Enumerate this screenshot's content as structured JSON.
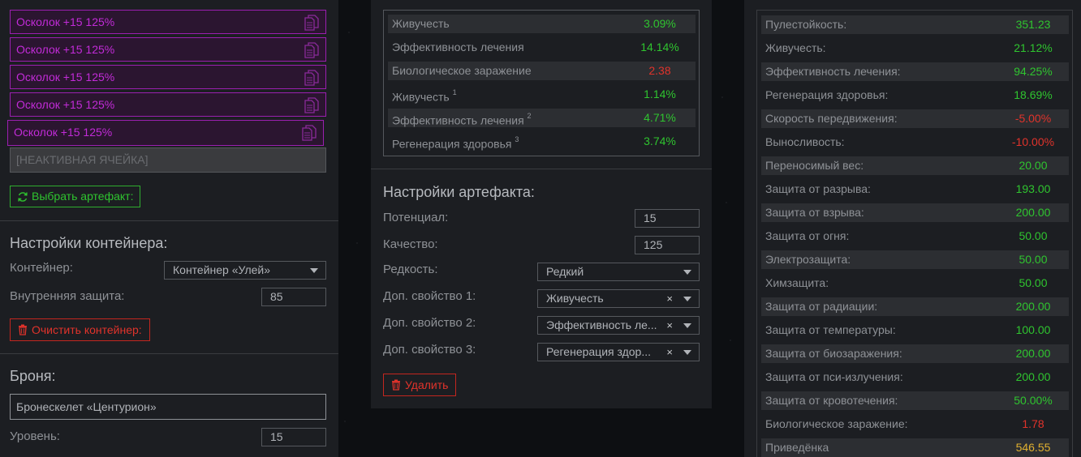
{
  "left": {
    "shards": [
      {
        "label": "Осколок +15 125%"
      },
      {
        "label": "Осколок +15 125%"
      },
      {
        "label": "Осколок +15 125%"
      },
      {
        "label": "Осколок +15 125%"
      },
      {
        "label": "Осколок +15 125%"
      }
    ],
    "inactive_cell": "[НЕАКТИВНАЯ ЯЧЕЙКА]",
    "choose_artifact": "Выбрать артефакт:",
    "container_settings_title": "Настройки контейнера:",
    "container_label": "Контейнер:",
    "container_value": "Контейнер «Улей»",
    "inner_protection_label": "Внутренняя защита:",
    "inner_protection_value": "85",
    "clear_container": "Очистить контейнер:",
    "armor_title": "Броня:",
    "armor_value": "Бронескелет «Центурион»",
    "level_label": "Уровень:",
    "level_value": "15"
  },
  "mid": {
    "stats": [
      {
        "name": "Живучесть",
        "sup": "",
        "value": "3.09%",
        "color": "green"
      },
      {
        "name": "Эффективность лечения",
        "sup": "",
        "value": "14.14%",
        "color": "green"
      },
      {
        "name": "Биологическое заражение",
        "sup": "",
        "value": "2.38",
        "color": "red"
      },
      {
        "name": "Живучесть",
        "sup": "1",
        "value": "1.14%",
        "color": "green"
      },
      {
        "name": "Эффективность лечения",
        "sup": "2",
        "value": "4.71%",
        "color": "green"
      },
      {
        "name": "Регенерация здоровья",
        "sup": "3",
        "value": "3.74%",
        "color": "green"
      }
    ],
    "artifact_settings_title": "Настройки артефакта:",
    "potential_label": "Потенциал:",
    "potential_value": "15",
    "quality_label": "Качество:",
    "quality_value": "125",
    "rarity_label": "Редкость:",
    "rarity_value": "Редкий",
    "extra1_label": "Доп. свойство 1:",
    "extra1_value": "Живучесть",
    "extra2_label": "Доп. свойство 2:",
    "extra2_value": "Эффективность ле...",
    "extra3_label": "Доп. свойство 3:",
    "extra3_value": "Регенерация здор...",
    "clear_symbol": "×",
    "delete_button": "Удалить"
  },
  "right": {
    "stats": [
      {
        "name": "Пулестойкость:",
        "value": "351.23",
        "color": "green"
      },
      {
        "name": "Живучесть:",
        "value": "21.12%",
        "color": "green"
      },
      {
        "name": "Эффективность лечения:",
        "value": "94.25%",
        "color": "green"
      },
      {
        "name": "Регенерация здоровья:",
        "value": "18.69%",
        "color": "green"
      },
      {
        "name": "Скорость передвижения:",
        "value": "-5.00%",
        "color": "red"
      },
      {
        "name": "Выносливость:",
        "value": "-10.00%",
        "color": "red"
      },
      {
        "name": "Переносимый вес:",
        "value": "20.00",
        "color": "green"
      },
      {
        "name": "Защита от разрыва:",
        "value": "193.00",
        "color": "green"
      },
      {
        "name": "Защита от взрыва:",
        "value": "200.00",
        "color": "green"
      },
      {
        "name": "Защита от огня:",
        "value": "50.00",
        "color": "green"
      },
      {
        "name": "Электрозащита:",
        "value": "50.00",
        "color": "green"
      },
      {
        "name": "Химзащита:",
        "value": "50.00",
        "color": "green"
      },
      {
        "name": "Защита от радиации:",
        "value": "200.00",
        "color": "green"
      },
      {
        "name": "Защита от температуры:",
        "value": "100.00",
        "color": "green"
      },
      {
        "name": "Защита от биозаражения:",
        "value": "200.00",
        "color": "green"
      },
      {
        "name": "Защита от пси-излучения:",
        "value": "200.00",
        "color": "green"
      },
      {
        "name": "Защита от кровотечения:",
        "value": "50.00%",
        "color": "green"
      },
      {
        "name": "Биологическое заражение:",
        "value": "1.78",
        "color": "red"
      },
      {
        "name": "Приведёнка",
        "value": "546.55",
        "color": "yellow"
      }
    ]
  },
  "colors": {
    "green": "#2fc42f",
    "red": "#e0332b",
    "yellow": "#e0b030",
    "shard": "#c22bd8"
  }
}
